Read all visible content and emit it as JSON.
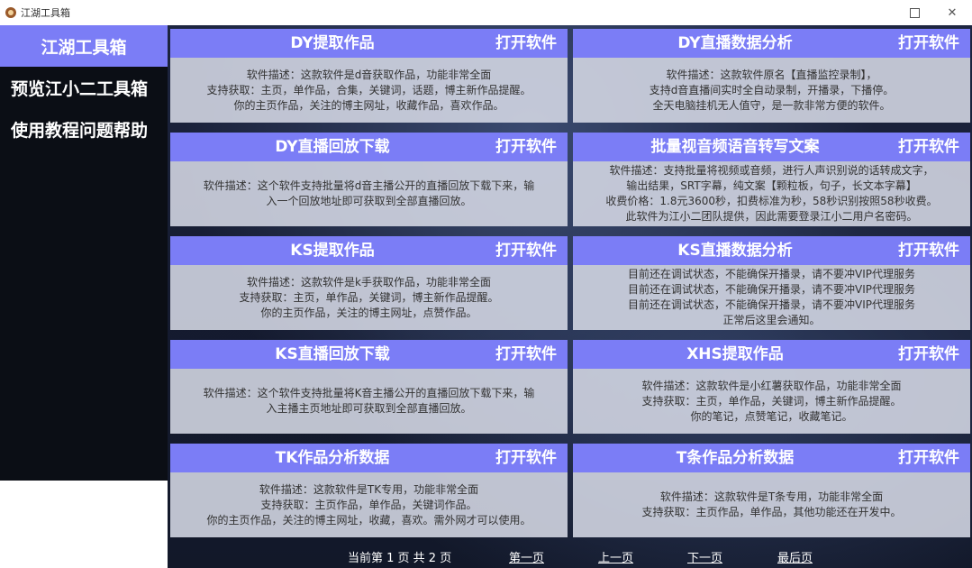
{
  "window": {
    "title": "江湖工具箱"
  },
  "sidebar": {
    "items": [
      {
        "label": "江湖工具箱"
      },
      {
        "label": "预览江小二工具箱"
      },
      {
        "label": "使用教程问题帮助"
      }
    ]
  },
  "cards": [
    {
      "title": "DY提取作品",
      "button": "打开软件",
      "lines": [
        "软件描述：这款软件是d音获取作品，功能非常全面",
        "支持获取：主页，单作品，合集，关键词，话题，博主新作品提醒。",
        "你的主页作品，关注的博主网址，收藏作品，喜欢作品。"
      ]
    },
    {
      "title": "DY直播数据分析",
      "button": "打开软件",
      "lines": [
        "软件描述：这款软件原名【直播监控录制】，",
        "支持d音直播间实时全自动录制，开播录，下播停。",
        "全天电脑挂机无人值守，是一款非常方便的软件。"
      ]
    },
    {
      "title": "DY直播回放下载",
      "button": "打开软件",
      "lines": [
        "软件描述：这个软件支持批量将d音主播公开的直播回放下载下来，输",
        "入一个回放地址即可获取到全部直播回放。"
      ]
    },
    {
      "title": "批量视音频语音转写文案",
      "button": "打开软件",
      "lines": [
        "软件描述：支持批量将视频或音频，进行人声识别说的话转成文字，",
        "输出结果，SRT字幕，纯文案【颗粒板，句子，长文本字幕】",
        "收费价格：1.8元3600秒，扣费标准为秒，58秒识别按照58秒收费。",
        "此软件为江小二团队提供，因此需要登录江小二用户名密码。"
      ]
    },
    {
      "title": "KS提取作品",
      "button": "打开软件",
      "lines": [
        "软件描述：这款软件是k手获取作品，功能非常全面",
        "支持获取：主页，单作品，关键词，博主新作品提醒。",
        "你的主页作品，关注的博主网址，点赞作品。"
      ]
    },
    {
      "title": "KS直播数据分析",
      "button": "打开软件",
      "lines": [
        "目前还在调试状态，不能确保开播录，请不要冲VIP代理服务",
        "目前还在调试状态，不能确保开播录，请不要冲VIP代理服务",
        "目前还在调试状态，不能确保开播录，请不要冲VIP代理服务",
        "正常后这里会通知。"
      ]
    },
    {
      "title": "KS直播回放下载",
      "button": "打开软件",
      "lines": [
        "软件描述：这个软件支持批量将K音主播公开的直播回放下载下来，输",
        "入主播主页地址即可获取到全部直播回放。"
      ]
    },
    {
      "title": "XHS提取作品",
      "button": "打开软件",
      "lines": [
        "软件描述：这款软件是小红薯获取作品，功能非常全面",
        "支持获取：主页，单作品，关键词，博主新作品提醒。",
        "你的笔记，点赞笔记，收藏笔记。"
      ]
    },
    {
      "title": "TK作品分析数据",
      "button": "打开软件",
      "lines": [
        "软件描述：这款软件是TK专用，功能非常全面",
        "支持获取：主页作品，单作品，关键词作品。",
        "你的主页作品，关注的博主网址，收藏，喜欢。需外网才可以使用。"
      ]
    },
    {
      "title": "T条作品分析数据",
      "button": "打开软件",
      "lines": [
        "软件描述：这款软件是T条专用，功能非常全面",
        "支持获取：主页作品，单作品，其他功能还在开发中。"
      ]
    }
  ],
  "pager": {
    "info": "当前第 1 页 共 2 页",
    "first": "第一页",
    "prev": "上一页",
    "next": "下一页",
    "last": "最后页"
  }
}
